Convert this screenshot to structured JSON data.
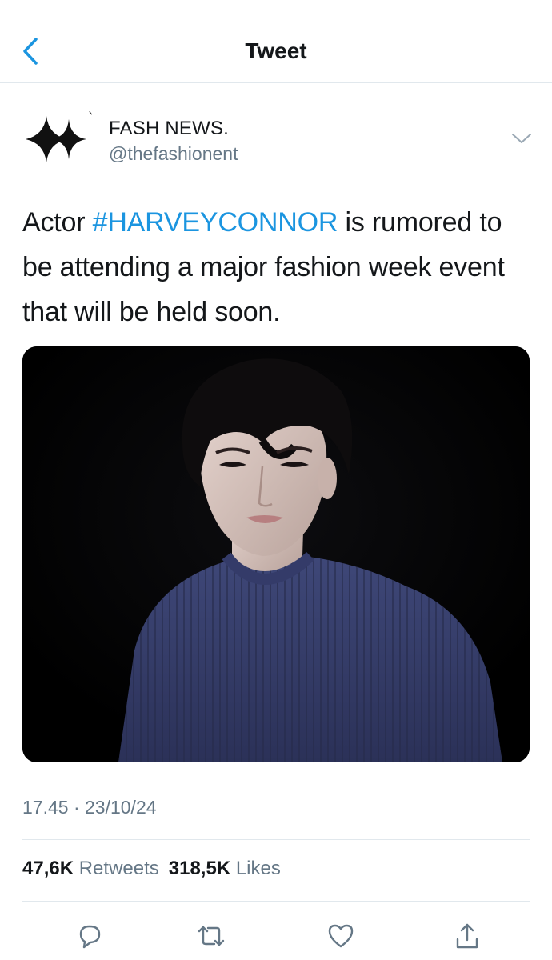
{
  "header": {
    "title": "Tweet",
    "back_icon": "chevron-left-icon"
  },
  "author": {
    "display_name": "FASH NEWS.",
    "handle": "@thefashionent",
    "avatar_icon": "sparkle-star-icon",
    "menu_icon": "chevron-down-icon"
  },
  "tweet": {
    "text_before": "Actor ",
    "hashtag": "#HARVEYCONNOR",
    "text_after": " is rumored to be attending a major fashion week event that will be held soon.",
    "media": {
      "kind": "photo",
      "description_icon": "portrait-photo"
    },
    "timestamp": "17.45 · 23/10/24"
  },
  "stats": {
    "retweets_count": "47,6K",
    "retweets_label": "Retweets",
    "likes_count": "318,5K",
    "likes_label": "Likes"
  },
  "actions": [
    {
      "name": "reply-icon"
    },
    {
      "name": "retweet-icon"
    },
    {
      "name": "like-icon"
    },
    {
      "name": "share-icon"
    }
  ],
  "colors": {
    "accent": "#1b95e0",
    "text": "#14171a",
    "secondary": "#657786",
    "divider": "#e1e8ed"
  }
}
